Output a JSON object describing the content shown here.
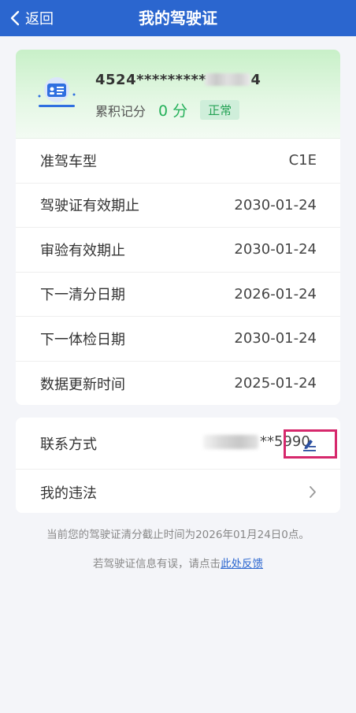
{
  "header": {
    "back_label": "返回",
    "title": "我的驾驶证"
  },
  "license": {
    "number_visible": "4524*********",
    "number_suffix": "4",
    "points_label": "累积记分",
    "points_value": "0 分",
    "status": "正常",
    "rows": [
      {
        "label": "准驾车型",
        "value": "C1E"
      },
      {
        "label": "驾驶证有效期止",
        "value": "2030-01-24"
      },
      {
        "label": "审验有效期止",
        "value": "2030-01-24"
      },
      {
        "label": "下一清分日期",
        "value": "2026-01-24"
      },
      {
        "label": "下一体检日期",
        "value": "2030-01-24"
      },
      {
        "label": "数据更新时间",
        "value": "2025-01-24"
      }
    ]
  },
  "contact": {
    "label": "联系方式",
    "phone_visible": "**5990"
  },
  "violations": {
    "label": "我的违法"
  },
  "footer": {
    "notice": "当前您的驾驶证清分截止时间为2026年01月24日0点。",
    "feedback_prefix": "若驾驶证信息有误，请点击",
    "feedback_link": "此处反馈"
  },
  "colors": {
    "header": "#2b66cf",
    "points": "#25b05a",
    "highlight": "#d6286c"
  }
}
